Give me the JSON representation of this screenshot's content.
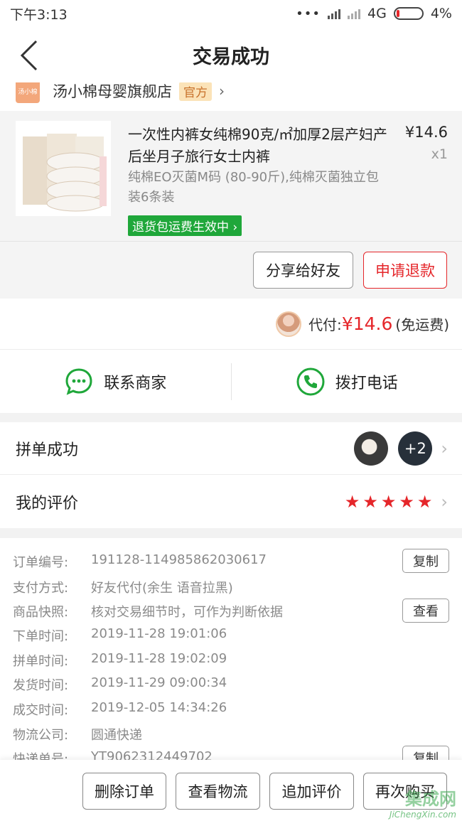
{
  "status_bar": {
    "time": "下午3:13",
    "network": "4G",
    "battery": "4%"
  },
  "nav": {
    "title": "交易成功"
  },
  "store": {
    "logo_text": "汤小棉",
    "name": "汤小棉母婴旗舰店",
    "badge": "官方"
  },
  "product": {
    "title": "一次性内裤女纯棉90克/㎡加厚2层产妇产后坐月子旅行女士内裤",
    "spec": "纯棉EO灭菌M码 (80-90斤),纯棉灭菌独立包装6条装",
    "price": "¥14.6",
    "qty": "x1",
    "return_tag": "退货包运费生效中",
    "share_button": "分享给好友",
    "refund_button": "申请退款"
  },
  "payment": {
    "label": "代付:",
    "amount": "¥14.6",
    "note": "(免运费)"
  },
  "contact": {
    "merchant": "联系商家",
    "call": "拨打电话"
  },
  "group": {
    "label": "拼单成功",
    "more_count": "+2"
  },
  "review": {
    "label": "我的评价",
    "stars": 5
  },
  "order_info": {
    "rows": [
      {
        "key": "订单编号:",
        "value": "191128-114985862030617"
      },
      {
        "key": "支付方式:",
        "value": "好友代付(余生 语音拉黑)"
      },
      {
        "key": "商品快照:",
        "value": "核对交易细节时，可作为判断依据"
      },
      {
        "key": "下单时间:",
        "value": "2019-11-28 19:01:06"
      },
      {
        "key": "拼单时间:",
        "value": "2019-11-28 19:02:09"
      },
      {
        "key": "发货时间:",
        "value": "2019-11-29 09:00:34"
      },
      {
        "key": "成交时间:",
        "value": "2019-12-05 14:34:26"
      },
      {
        "key": "物流公司:",
        "value": "圆通快递"
      },
      {
        "key": "快递单号:",
        "value": "YT9062312449702"
      }
    ],
    "copy_label": "复制",
    "view_label": "查看"
  },
  "bottom": {
    "delete": "删除订单",
    "logistics": "查看物流",
    "add_review": "追加评价",
    "buy_again": "再次购买"
  },
  "watermark": {
    "logo": "集成网",
    "url": "JiChengXin.com"
  },
  "colors": {
    "accent_red": "#e5262a",
    "green": "#1fa73a",
    "icon_green": "#1fa73a"
  }
}
